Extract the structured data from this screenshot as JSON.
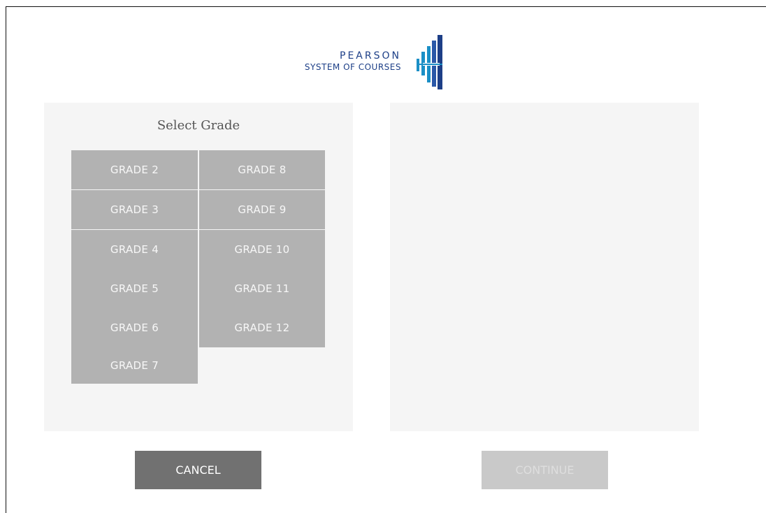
{
  "logo": {
    "brand": "PEARSON",
    "subtitle": "SYSTEM OF COURSES"
  },
  "grade_panel": {
    "title": "Select Grade",
    "grades_left": [
      "GRADE 2",
      "GRADE 3",
      "GRADE 4",
      "GRADE 5",
      "GRADE 6",
      "GRADE 7"
    ],
    "grades_right": [
      "GRADE 8",
      "GRADE 9",
      "GRADE 10",
      "GRADE 11",
      "GRADE 12"
    ]
  },
  "actions": {
    "cancel_label": "CANCEL",
    "continue_label": "CONTINUE"
  },
  "colors": {
    "brand_blue": "#1d3f87",
    "brand_teal": "#1b8fc6",
    "grade_button": "#b2b2b2",
    "cancel_button": "#717171",
    "continue_disabled": "#c9c9c9",
    "panel_bg": "#f5f5f5"
  }
}
